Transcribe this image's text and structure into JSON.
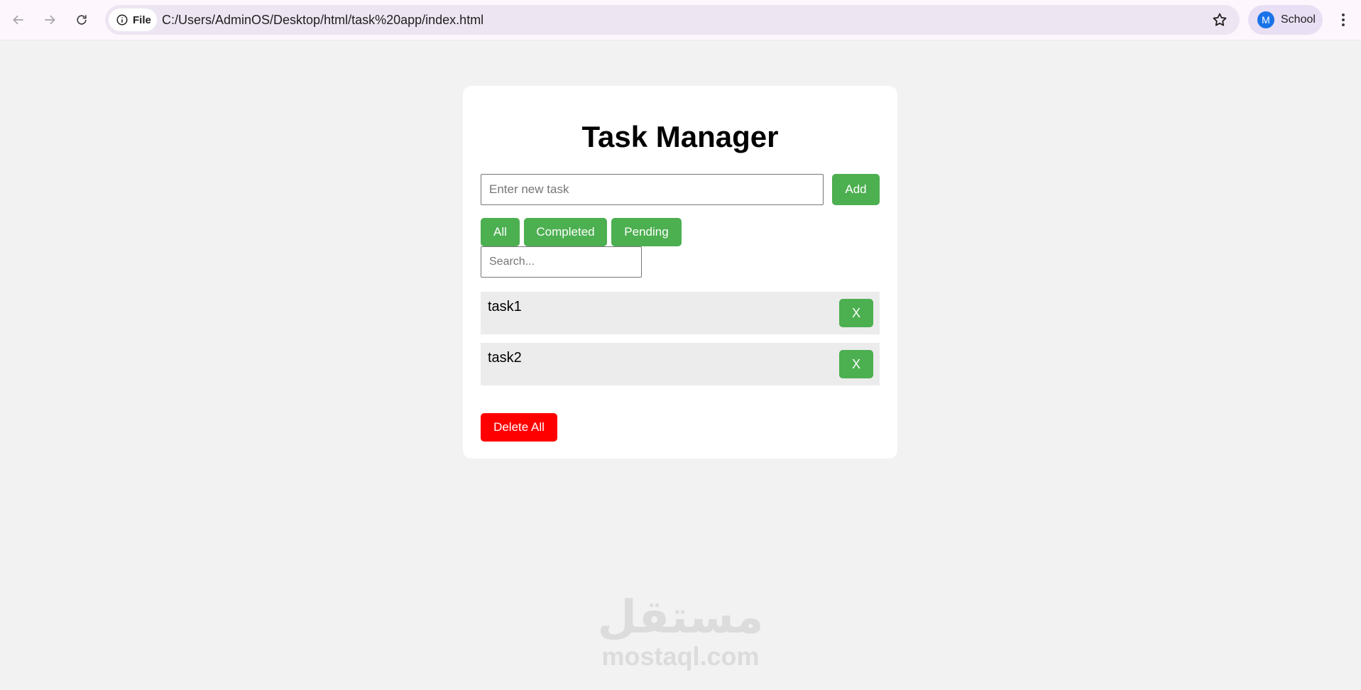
{
  "browser": {
    "back_icon": "arrow-left-icon",
    "forward_icon": "arrow-right-icon",
    "reload_icon": "reload-icon",
    "site_info_label": "File",
    "url": "C:/Users/AdminOS/Desktop/html/task%20app/index.html",
    "bookmark_icon": "star-icon",
    "profile": {
      "initial": "M",
      "name": "School"
    },
    "menu_icon": "kebab-menu-icon"
  },
  "app": {
    "title": "Task Manager",
    "task_input": {
      "value": "",
      "placeholder": "Enter new task"
    },
    "add_label": "Add",
    "filters": [
      {
        "label": "All"
      },
      {
        "label": "Completed"
      },
      {
        "label": "Pending"
      }
    ],
    "search": {
      "value": "",
      "placeholder": "Search..."
    },
    "tasks": [
      {
        "text": "task1",
        "delete_label": "X"
      },
      {
        "text": "task2",
        "delete_label": "X"
      }
    ],
    "delete_all_label": "Delete All"
  },
  "watermark": {
    "logo": "مستقل",
    "domain": "mostaql.com"
  },
  "colors": {
    "accent_green": "#4caf50",
    "danger_red": "#ff0000",
    "page_bg": "#f2f2f2",
    "task_row_bg": "#ececec"
  }
}
